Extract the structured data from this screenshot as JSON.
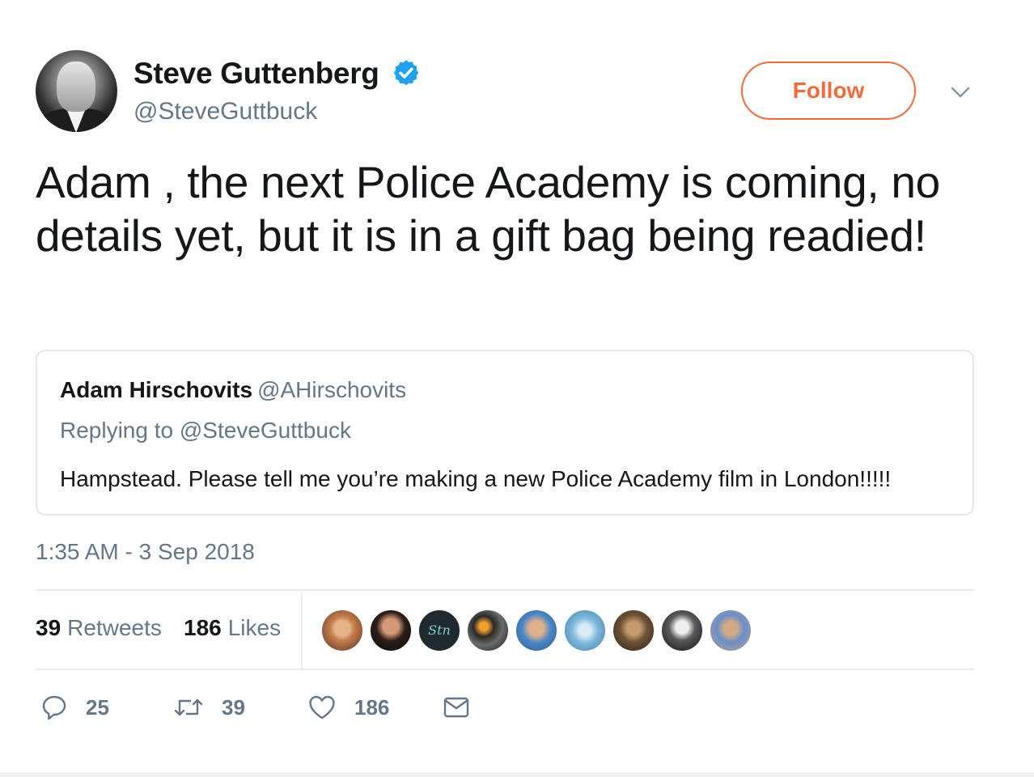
{
  "author": {
    "display_name": "Steve Guttenberg",
    "handle": "@SteveGuttbuck",
    "verified": true
  },
  "follow_label": "Follow",
  "tweet_text": "Adam , the next Police Academy is coming, no details yet, but it is in a gift bag being readied!",
  "quoted": {
    "name": "Adam Hirschovits",
    "handle": "@AHirschovits",
    "replying_to": "Replying to @SteveGuttbuck",
    "text": "Hampstead. Please tell me you’re making a new Police Academy film in London!!!!!"
  },
  "timestamp": "1:35 AM - 3 Sep 2018",
  "stats": {
    "retweets_count": "39",
    "retweets_label": "Retweets",
    "likes_count": "186",
    "likes_label": "Likes"
  },
  "actions": {
    "replies": "25",
    "retweets": "39",
    "likes": "186"
  },
  "colors": {
    "accent": "#f26b3a",
    "verified": "#1da1f2",
    "secondary_text": "#657786",
    "border": "#e1e8ed"
  },
  "icons": {
    "verified": "verified-badge-icon",
    "caret": "chevron-down-icon",
    "reply": "reply-icon",
    "retweet": "retweet-icon",
    "like": "heart-icon",
    "message": "envelope-icon"
  }
}
